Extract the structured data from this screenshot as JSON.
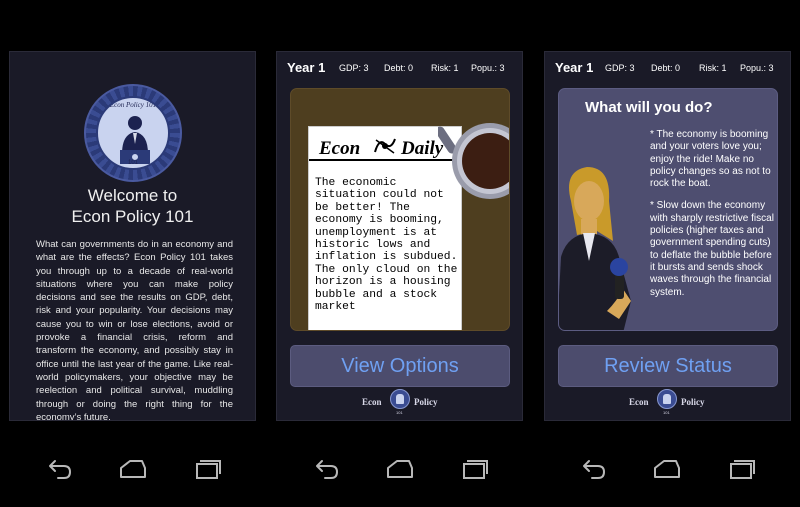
{
  "screen1": {
    "seal": {
      "ring_text": "Econ Policy 101",
      "number": "101"
    },
    "title_line1": "Welcome to",
    "title_line2": "Econ Policy 101",
    "body": "What can governments do in an economy and what are the effects? Econ Policy 101 takes you through up to a decade of real-world situations where you can make policy decisions and see the results on GDP, debt, risk and your popularity. Your decisions may cause you to win or lose elections, avoid or provoke a financial crisis, reform and transform the economy, and possibly stay in office until the last year of the game. Like real-world policymakers, your objective may be reelection and political survival, muddling through or doing the right thing for the economy’s future."
  },
  "status_bar": {
    "year": "Year 1",
    "gdp": "GDP: 3",
    "debt": "Debt: 0",
    "risk": "Risk: 1",
    "popularity": "Popu.: 3"
  },
  "screen2": {
    "newspaper": {
      "masthead_left": "Econ",
      "masthead_right": "Daily",
      "story": "The economic situation could not be better! The economy is booming, unemployment is at historic lows and inflation is subdued. The only cloud on the horizon is a housing bubble and a stock market"
    },
    "button_label": "View Options"
  },
  "screen3": {
    "title": "What will you do?",
    "options": [
      "* The economy is booming and your voters love you; enjoy the ride! Make no policy changes so as not to rock the boat.",
      "* Slow down the economy with sharply restrictive fiscal policies (higher taxes and government spending cuts) to deflate the bubble before it bursts and sends shock waves through the financial system."
    ],
    "button_label": "Review Status"
  },
  "footer_logo": {
    "left": "Econ",
    "right": "Policy",
    "number": "101"
  },
  "colors": {
    "screen_bg": "#1a1a27",
    "button_bg": "#4c4c6d",
    "button_text": "#6fa0f2",
    "newspaper_frame": "#4e3e1f",
    "panel_bg": "#4e4e70"
  },
  "nav_icons": [
    "back-icon",
    "home-icon",
    "recent-apps-icon"
  ]
}
